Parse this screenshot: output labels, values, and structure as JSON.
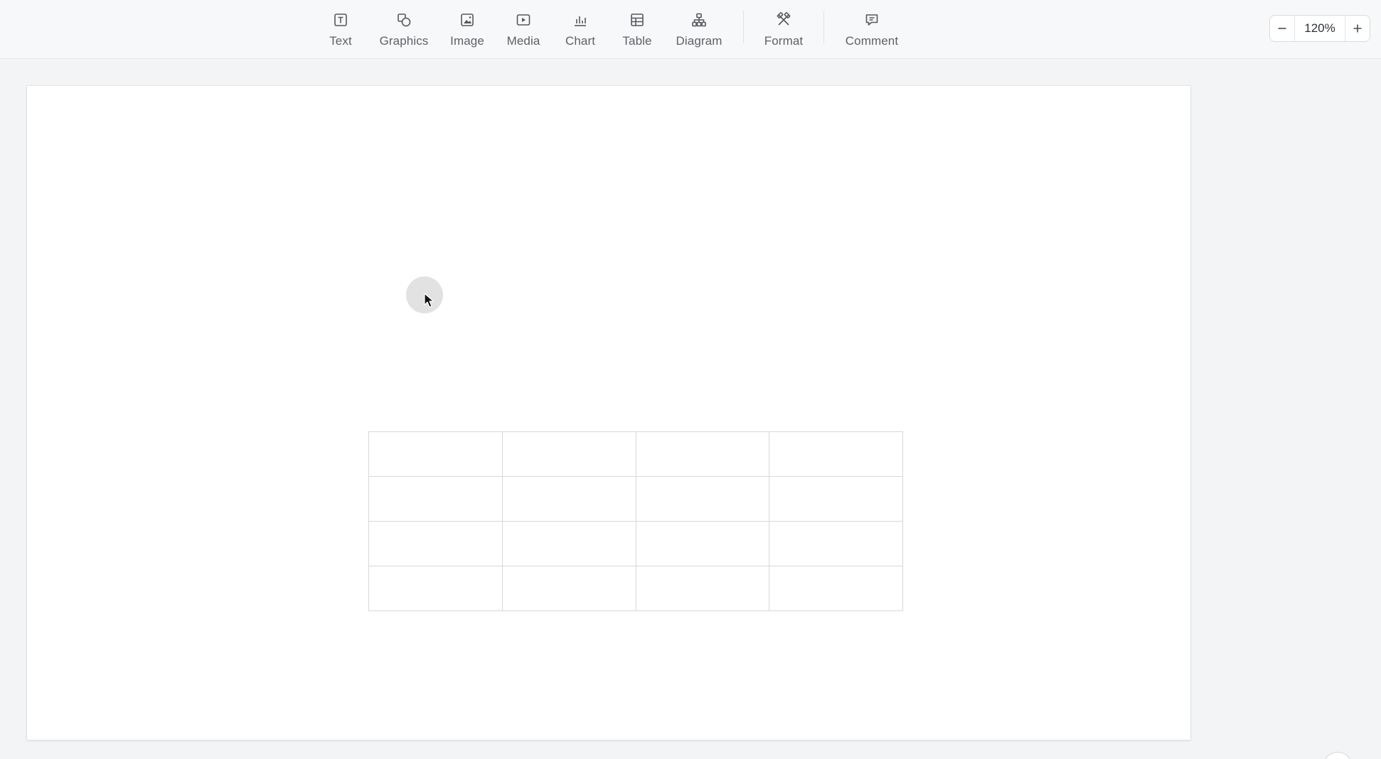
{
  "toolbar": {
    "items": [
      {
        "label": "Text",
        "icon": "text-icon"
      },
      {
        "label": "Graphics",
        "icon": "shapes-icon"
      },
      {
        "label": "Image",
        "icon": "image-icon"
      },
      {
        "label": "Media",
        "icon": "media-play-icon"
      },
      {
        "label": "Chart",
        "icon": "bar-chart-icon"
      },
      {
        "label": "Table",
        "icon": "table-icon"
      },
      {
        "label": "Diagram",
        "icon": "org-chart-icon"
      },
      {
        "label": "Format",
        "icon": "format-tools-icon"
      },
      {
        "label": "Comment",
        "icon": "comment-icon"
      }
    ]
  },
  "zoom": {
    "value": "120%",
    "decrease_icon": "minus-icon",
    "increase_icon": "plus-icon"
  },
  "slide": {
    "table": {
      "rows": 4,
      "columns": 4
    }
  },
  "colors": {
    "toolbar_bg": "#f7f8f9",
    "label": "#5d6166",
    "canvas_bg": "#f3f4f6",
    "slide_bg": "#ffffff",
    "table_border": "#d6d8db"
  }
}
